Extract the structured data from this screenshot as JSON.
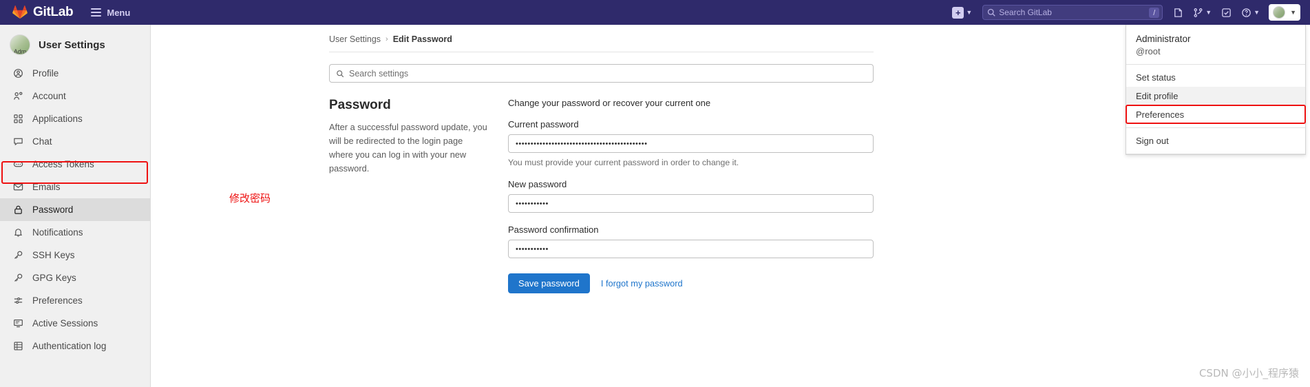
{
  "navbar": {
    "brand": "GitLab",
    "menu_label": "Menu",
    "plus_label": "+",
    "search_placeholder": "Search GitLab",
    "search_shortcut": "/",
    "icons": [
      "plus-icon",
      "search-icon",
      "merge-requests-icon",
      "issues-icon",
      "todos-icon",
      "help-icon",
      "user-avatar"
    ]
  },
  "sidebar": {
    "title": "User Settings",
    "avatar_label": "Adm",
    "items": [
      {
        "label": "Profile",
        "icon": "user-circle-icon",
        "active": false
      },
      {
        "label": "Account",
        "icon": "account-icon",
        "active": false
      },
      {
        "label": "Applications",
        "icon": "applications-grid-icon",
        "active": false
      },
      {
        "label": "Chat",
        "icon": "chat-bubble-icon",
        "active": false
      },
      {
        "label": "Access Tokens",
        "icon": "token-icon",
        "active": false
      },
      {
        "label": "Emails",
        "icon": "envelope-icon",
        "active": false
      },
      {
        "label": "Password",
        "icon": "lock-icon",
        "active": true
      },
      {
        "label": "Notifications",
        "icon": "bell-icon",
        "active": false
      },
      {
        "label": "SSH Keys",
        "icon": "key-icon",
        "active": false
      },
      {
        "label": "GPG Keys",
        "icon": "key-icon",
        "active": false
      },
      {
        "label": "Preferences",
        "icon": "sliders-icon",
        "active": false
      },
      {
        "label": "Active Sessions",
        "icon": "monitor-icon",
        "active": false
      },
      {
        "label": "Authentication log",
        "icon": "list-grid-icon",
        "active": false
      }
    ]
  },
  "breadcrumb": {
    "parent": "User Settings",
    "separator": "›",
    "current": "Edit Password"
  },
  "search_settings": {
    "placeholder": "Search settings"
  },
  "password_section": {
    "heading": "Password",
    "description": "After a successful password update, you will be redirected to the login page where you can log in with your new password.",
    "form_legend": "Change your password or recover your current one",
    "current_password": {
      "label": "Current password",
      "value": "••••••••••••••••••••••••••••••••••••••••••••",
      "help": "You must provide your current password in order to change it."
    },
    "new_password": {
      "label": "New password",
      "value": "•••••••••••"
    },
    "password_confirmation": {
      "label": "Password confirmation",
      "value": "•••••••••••"
    },
    "save_button": "Save password",
    "forgot_link": "I forgot my password"
  },
  "annotation": {
    "note": "修改密码",
    "color": "#ee1111"
  },
  "user_dropdown": {
    "name": "Administrator",
    "handle": "@root",
    "items": [
      {
        "label": "Set status",
        "selected": false
      },
      {
        "label": "Edit profile",
        "selected": true
      },
      {
        "label": "Preferences",
        "selected": false
      },
      {
        "label": "Sign out",
        "selected": false
      }
    ]
  },
  "watermark": "CSDN @小小_程序猿",
  "colors": {
    "navbar": "#2f2a6b",
    "sidebar": "#f0f0f0",
    "primary_button": "#1f75cb",
    "link": "#1f75cb",
    "highlight": "#ee1111"
  }
}
